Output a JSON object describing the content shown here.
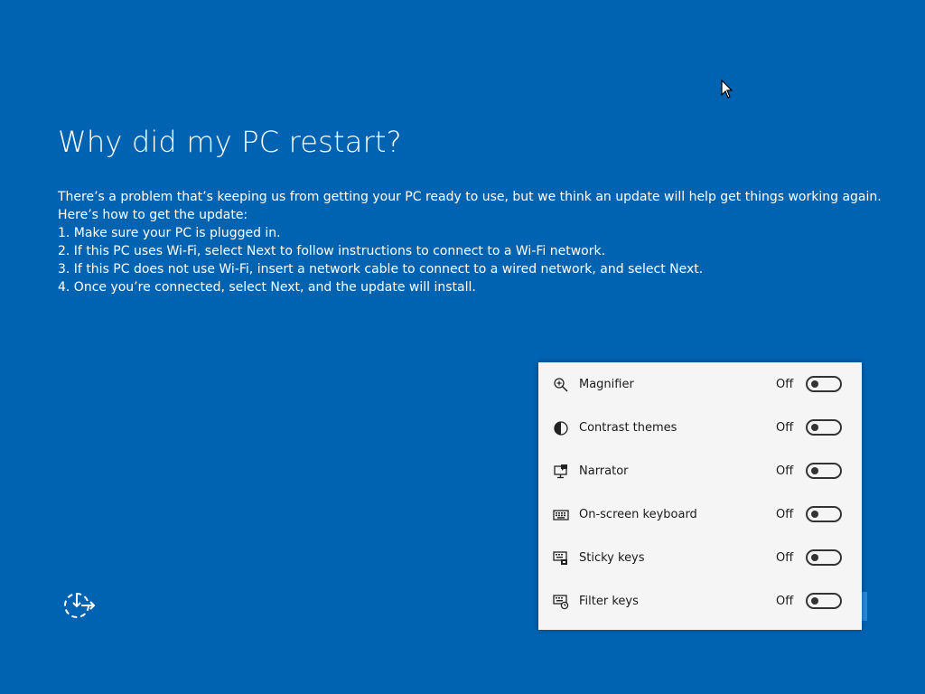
{
  "title": "Why did my PC restart?",
  "body": {
    "line1": "There’s a problem that’s keeping us from getting your PC ready to use, but we think an update will help get things working again.",
    "line2": "Here’s how to get the update:",
    "steps": [
      "1. Make sure your PC is plugged in.",
      "2. If this PC uses Wi-Fi, select Next to follow instructions to connect to a Wi-Fi network.",
      "3. If this PC does not use Wi-Fi, insert a network cable to connect to a wired network, and select Next.",
      "4. Once you’re connected, select Next, and the update will install."
    ]
  },
  "accessibility": {
    "items": [
      {
        "label": "Magnifier",
        "state": "Off",
        "icon": "magnifier-icon"
      },
      {
        "label": "Contrast themes",
        "state": "Off",
        "icon": "contrast-icon"
      },
      {
        "label": "Narrator",
        "state": "Off",
        "icon": "narrator-icon"
      },
      {
        "label": "On-screen keyboard",
        "state": "Off",
        "icon": "keyboard-icon"
      },
      {
        "label": "Sticky keys",
        "state": "Off",
        "icon": "sticky-keys-icon"
      },
      {
        "label": "Filter keys",
        "state": "Off",
        "icon": "filter-keys-icon"
      }
    ]
  },
  "ease_of_access_icon": "ease-of-access-icon",
  "colors": {
    "background": "#0063b1",
    "panel": "#f5f5f5",
    "accent": "#2b88d8"
  }
}
